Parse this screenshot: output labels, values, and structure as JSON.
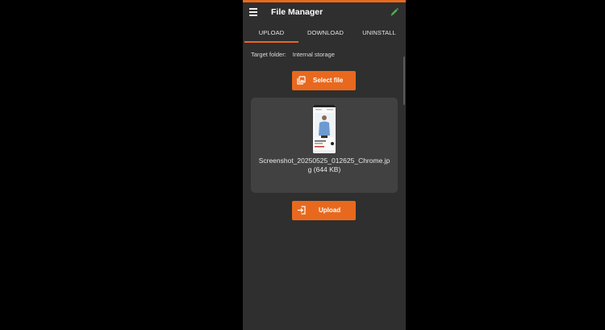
{
  "app": {
    "title": "File Manager",
    "icons": {
      "menu": "menu-icon",
      "edit": "pencil-icon"
    }
  },
  "tabs": [
    {
      "label": "UPLOAD",
      "active": true
    },
    {
      "label": "DOWNLOAD",
      "active": false
    },
    {
      "label": "UNINSTALL",
      "active": false
    }
  ],
  "target": {
    "label": "Target folder:",
    "value": "Internal storage"
  },
  "select_button": {
    "label": "Select file",
    "icon": "gallery-icon"
  },
  "selected_file": {
    "name": "Screenshot_20250525_012625_Chrome.jpg (644 KB)",
    "thumbnail_icon": "image-thumbnail"
  },
  "upload_button": {
    "label": "Upload",
    "icon": "upload-arrow-icon"
  },
  "colors": {
    "accent": "#e8691e",
    "background": "#2f2f2f",
    "card": "#414141",
    "edit_icon": "#4caf50"
  }
}
